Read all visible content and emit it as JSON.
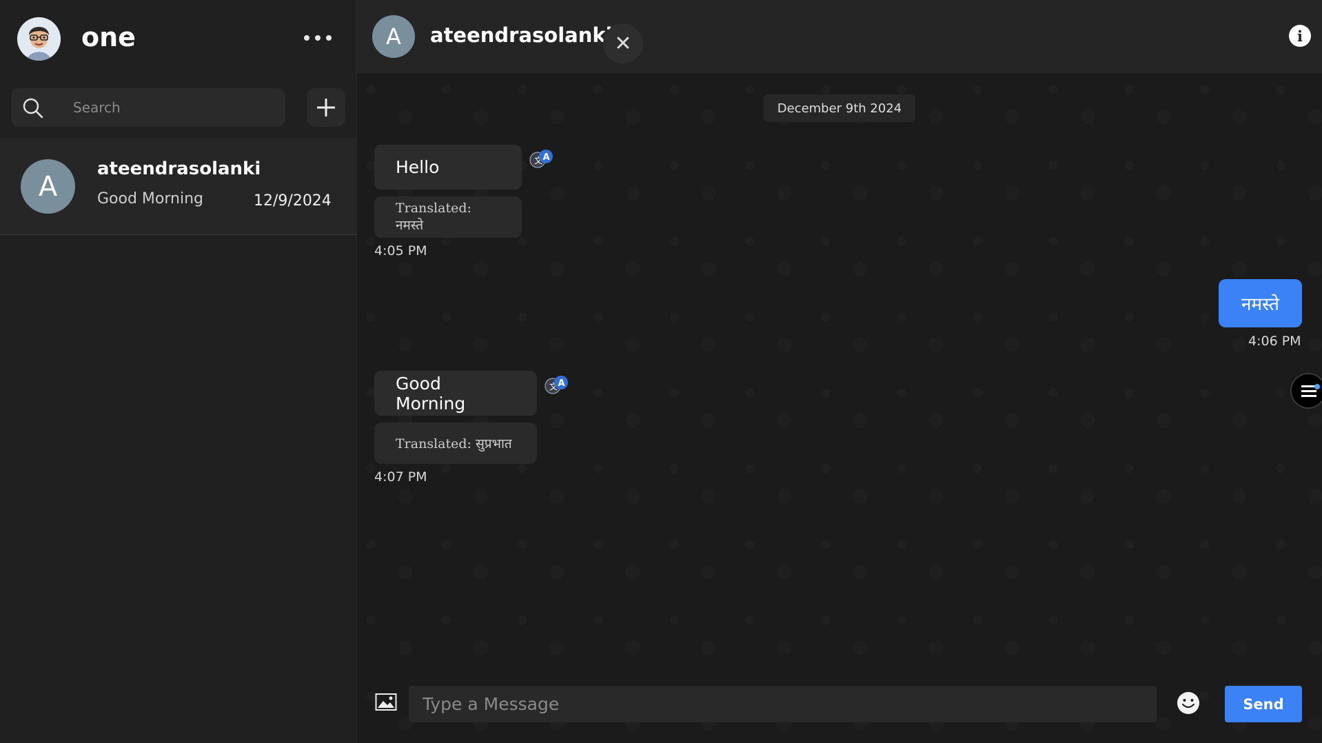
{
  "sidebar": {
    "profile_name": "one",
    "search_placeholder": "Search",
    "chats": [
      {
        "avatar_letter": "A",
        "name": "ateendrasolanki",
        "preview": "Good Morning",
        "date": "12/9/2024"
      }
    ]
  },
  "chat": {
    "contact_letter": "A",
    "contact_name": "ateendrasolanki",
    "close_glyph": "✕",
    "info_glyph": "i",
    "date_divider": "December 9th 2024",
    "messages": [
      {
        "direction": "incoming",
        "text": "Hello",
        "translation": "Translated: नमस्ते",
        "time": "4:05 PM"
      },
      {
        "direction": "outgoing",
        "text": "नमस्ते",
        "time": "4:06 PM"
      },
      {
        "direction": "incoming",
        "text": "Good Morning",
        "translation": "Translated: सुप्रभात",
        "time": "4:07 PM"
      }
    ]
  },
  "composer": {
    "placeholder": "Type a Message",
    "send_label": "Send"
  },
  "colors": {
    "accent": "#3b82f6",
    "sidebar_bg": "#202020",
    "chat_bg": "#1b1b1b",
    "bubble_in": "#2c2c2c"
  },
  "icons": [
    "profile-avatar",
    "more-icon",
    "search-icon",
    "plus-icon",
    "close-icon",
    "info-icon",
    "translate-icon",
    "menu-icon",
    "image-icon",
    "emoji-icon"
  ]
}
